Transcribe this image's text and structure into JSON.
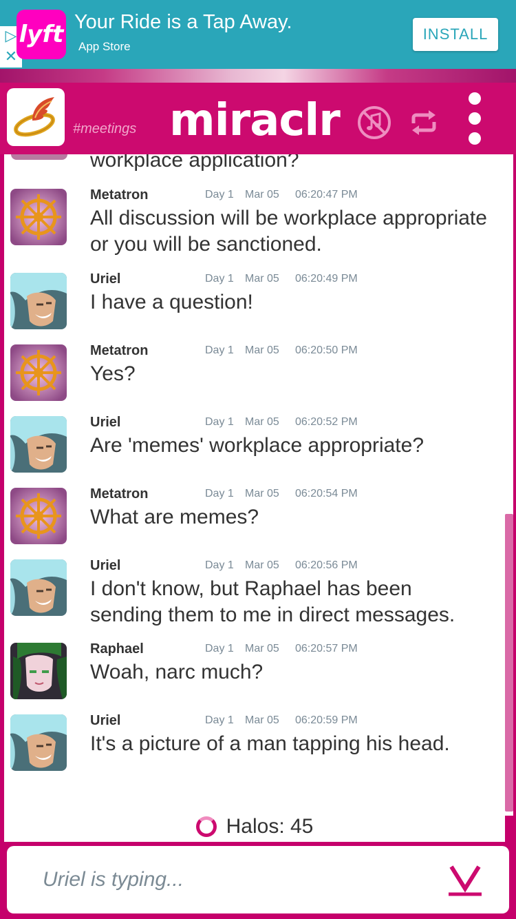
{
  "ad": {
    "brand_logo_text": "lyft",
    "title": "Your Ride is a Tap Away.",
    "store": "App Store",
    "install_label": "INSTALL",
    "adchoices_icon": "adchoices-icon",
    "close_icon": "close-icon"
  },
  "header": {
    "app_name": "miraclr",
    "channel": "#meetings",
    "channel_icon": "halo-wings-icon",
    "mute_icon": "music-muted-icon",
    "refresh_icon": "refresh-icon",
    "menu_icon": "more-vertical-icon"
  },
  "chat": {
    "top_partial_text": "workplace application?",
    "messages": [
      {
        "name": "Metatron",
        "day": "Day 1",
        "date": "Mar 05",
        "time": "06:20:47 PM",
        "text": "All discussion will be workplace appropriate or you will be sanctioned.",
        "avatar": "wheel-avatar"
      },
      {
        "name": "Uriel",
        "day": "Day 1",
        "date": "Mar 05",
        "time": "06:20:49 PM",
        "text": "I have a question!",
        "avatar": "uriel-avatar"
      },
      {
        "name": "Metatron",
        "day": "Day 1",
        "date": "Mar 05",
        "time": "06:20:50 PM",
        "text": "Yes?",
        "avatar": "wheel-avatar"
      },
      {
        "name": "Uriel",
        "day": "Day 1",
        "date": "Mar 05",
        "time": "06:20:52 PM",
        "text": "Are 'memes' workplace appropriate?",
        "avatar": "uriel-avatar"
      },
      {
        "name": "Metatron",
        "day": "Day 1",
        "date": "Mar 05",
        "time": "06:20:54 PM",
        "text": "What are memes?",
        "avatar": "wheel-avatar"
      },
      {
        "name": "Uriel",
        "day": "Day 1",
        "date": "Mar 05",
        "time": "06:20:56 PM",
        "text": "I don't know, but Raphael has been sending them to me in direct messages.",
        "avatar": "uriel-avatar"
      },
      {
        "name": "Raphael",
        "day": "Day 1",
        "date": "Mar 05",
        "time": "06:20:57 PM",
        "text": "Woah, narc much?",
        "avatar": "raphael-avatar"
      },
      {
        "name": "Uriel",
        "day": "Day 1",
        "date": "Mar 05",
        "time": "06:20:59 PM",
        "text": "It's a picture of a man tapping his head.",
        "avatar": "uriel-avatar"
      }
    ]
  },
  "halos": {
    "label": "Halos: 45",
    "icon": "halo-icon"
  },
  "input": {
    "placeholder": "Uriel is typing...",
    "send_icon": "send-chevron-icon"
  },
  "colors": {
    "ad_background": "#2aa6b9",
    "brand": "#cc0a6f",
    "scrollbar": "#da6aa7",
    "text": "#333333",
    "meta": "#7a8a96"
  }
}
